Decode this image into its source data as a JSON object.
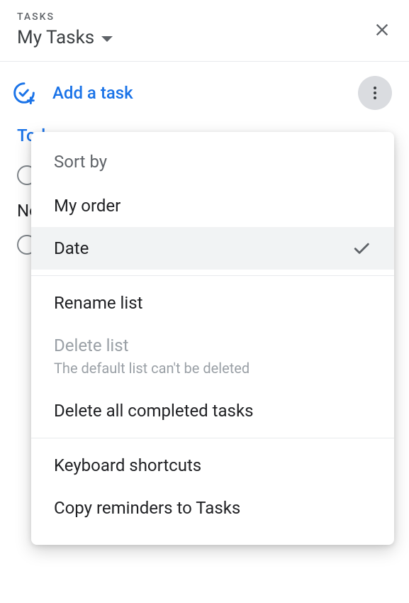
{
  "header": {
    "label": "TASKS",
    "title": "My Tasks"
  },
  "toolbar": {
    "add_label": "Add a task"
  },
  "content": {
    "section_today": "Today",
    "no_date_label": "No date"
  },
  "menu": {
    "sort_header": "Sort by",
    "my_order": "My order",
    "date": "Date",
    "rename": "Rename list",
    "delete": "Delete list",
    "delete_sub": "The default list can't be deleted",
    "delete_completed": "Delete all completed tasks",
    "shortcuts": "Keyboard shortcuts",
    "copy_reminders": "Copy reminders to Tasks"
  }
}
